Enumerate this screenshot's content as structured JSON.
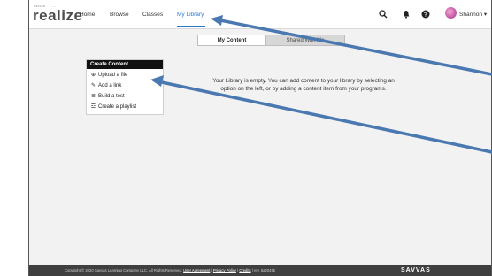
{
  "logo": {
    "word": "realize",
    "superscript": "SAVVAS",
    "dots": "···"
  },
  "nav": {
    "home": "Home",
    "browse": "Browse",
    "classes": "Classes",
    "my_library": "My Library"
  },
  "header": {
    "user_name": "Shannon ▾",
    "icons": [
      "search-icon",
      "bell-icon",
      "help-icon"
    ]
  },
  "tabs": {
    "my_content": "My Content",
    "shared": "Shared With Me"
  },
  "create_panel": {
    "title": "Create Content",
    "items": [
      {
        "icon": "upload-icon",
        "glyph": "⊕",
        "label": "Upload a file"
      },
      {
        "icon": "link-icon",
        "glyph": "✎",
        "label": "Add a link"
      },
      {
        "icon": "test-icon",
        "glyph": "≣",
        "label": "Build a test"
      },
      {
        "icon": "playlist-icon",
        "glyph": "☲",
        "label": "Create a playlist"
      }
    ]
  },
  "empty_message": {
    "line1": "Your Library is empty. You can add content to your library by selecting an",
    "line2": "option on the left, or by adding a content item from your programs."
  },
  "footer": {
    "copyright": "Copyright © 2020 Savvas Learning Company LLC. All Rights Reserved.",
    "user_agreement": "User Agreement",
    "privacy": "Privacy Policy",
    "credits": "Credits",
    "version": "rev. 5a2049b",
    "brand": "SAVVAS"
  },
  "colors": {
    "accent": "#2a7bd4",
    "annotation_arrow": "#4a78b0"
  }
}
